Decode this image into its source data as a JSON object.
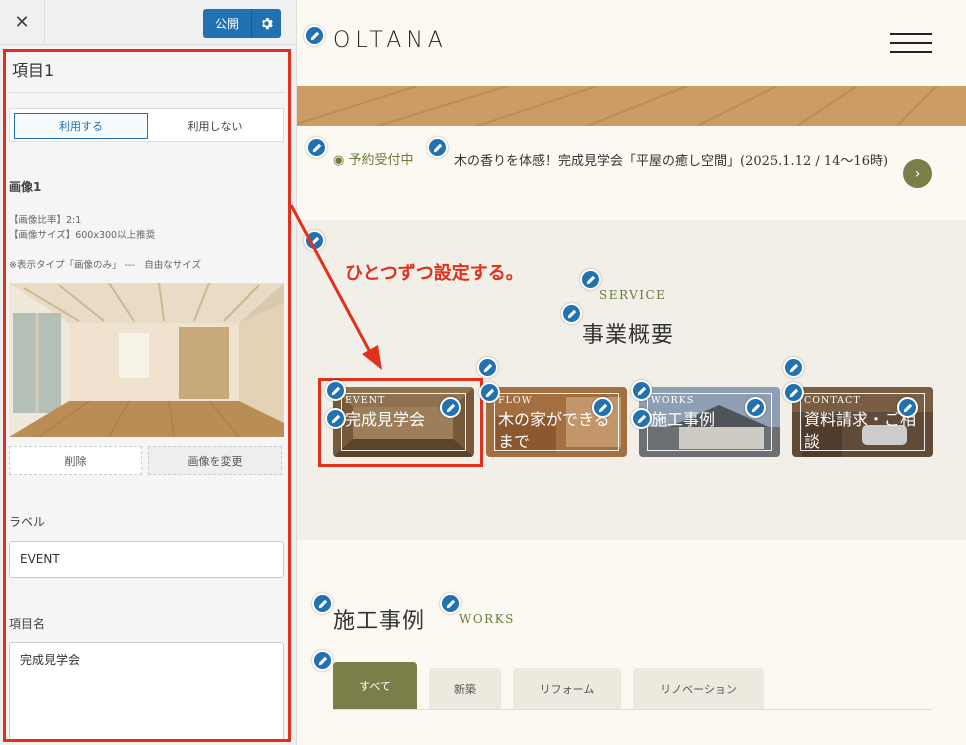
{
  "topbar": {
    "close_glyph": "✕",
    "publish_label": "公開",
    "gear_icon": "gear-icon"
  },
  "panel": {
    "item_title": "項目1",
    "use_toggle": {
      "on_label": "利用する",
      "off_label": "利用しない",
      "selected": "利用する"
    },
    "image_heading": "画像1",
    "note_ratio": "【画像比率】2:1",
    "note_size": "【画像サイズ】600x300以上推奨",
    "note_type": "※表示タイプ「画像のみ」 ---　自由なサイズ",
    "delete_label": "削除",
    "change_label": "画像を変更",
    "label_heading": "ラベル",
    "label_value": "EVENT",
    "name_heading": "項目名",
    "name_value": "完成見学会"
  },
  "site": {
    "logo": "OLTANA",
    "news": {
      "label": "◉ 予約受付中",
      "text": "木の香りを体感！完成見学会「平屋の癒し空間」(2025.1.12 / 14〜16時)",
      "next_glyph": "›"
    },
    "annotation": "ひとつずつ設定する。",
    "service": {
      "en": "SERVICE",
      "jp": "事業概要",
      "cards": [
        {
          "label": "EVENT",
          "name": "完成見学会"
        },
        {
          "label": "FLOW",
          "name": "木の家ができるまで"
        },
        {
          "label": "WORKS",
          "name": "施工事例"
        },
        {
          "label": "CONTACT",
          "name": "資料請求・ご相談"
        }
      ]
    },
    "works": {
      "jp": "施工事例",
      "en": "WORKS",
      "tabs": [
        "すべて",
        "新築",
        "リフォーム",
        "リノベーション"
      ],
      "active_tab": "すべて"
    }
  },
  "colors": {
    "accent_blue": "#2271b1",
    "annotation_red": "#e1301c",
    "brand_olive": "#7a7f4a",
    "site_bg": "#fbf9f1"
  }
}
